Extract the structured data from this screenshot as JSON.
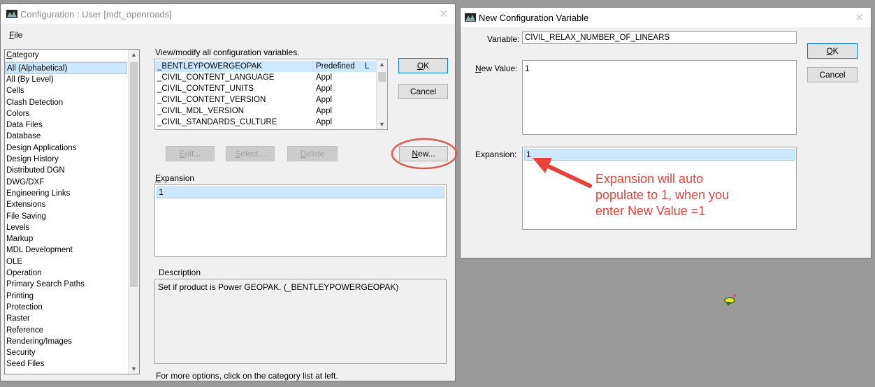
{
  "config_window": {
    "title": "Configuration : User [mdt_openroads]",
    "menu_file": "File",
    "category_header": "Category",
    "categories": [
      "All (Alphabetical)",
      "All (By Level)",
      "Cells",
      "Clash Detection",
      "Colors",
      "Data Files",
      "Database",
      "Design Applications",
      "Design History",
      "Distributed DGN",
      "DWG/DXF",
      "Engineering Links",
      "Extensions",
      "File Saving",
      "Levels",
      "Markup",
      "MDL Development",
      "OLE",
      "Operation",
      "Primary Search Paths",
      "Printing",
      "Protection",
      "Raster",
      "Reference",
      "Rendering/Images",
      "Security",
      "Seed Files"
    ],
    "view_label": "View/modify all configuration variables.",
    "variables": [
      {
        "name": "_BENTLEYPOWERGEOPAK",
        "level": "Predefined",
        "lock": "L"
      },
      {
        "name": "_CIVIL_CONTENT_LANGUAGE",
        "level": "Appl",
        "lock": ""
      },
      {
        "name": "_CIVIL_CONTENT_UNITS",
        "level": "Appl",
        "lock": ""
      },
      {
        "name": "_CIVIL_CONTENT_VERSION",
        "level": "Appl",
        "lock": ""
      },
      {
        "name": "_CIVIL_MDL_VERSION",
        "level": "Appl",
        "lock": ""
      },
      {
        "name": "_CIVIL_STANDARDS_CULTURE",
        "level": "Appl",
        "lock": ""
      }
    ],
    "ok_label": "OK",
    "cancel_label": "Cancel",
    "edit_label": "Edit...",
    "select_label": "Select...",
    "delete_label": "Delete",
    "new_label": "New...",
    "expansion_label": "Expansion",
    "expansion_value": "1",
    "description_label": "Description",
    "description_value": "Set if product is Power GEOPAK. (_BENTLEYPOWERGEOPAK)",
    "footer_hint": "For more options, click on the category list at left."
  },
  "new_var_dialog": {
    "title": "New Configuration Variable",
    "variable_label": "Variable:",
    "variable_value": "CIVIL_RELAX_NUMBER_OF_LINEARS",
    "new_value_label": "New Value:",
    "new_value": "1",
    "expansion_label": "Expansion:",
    "expansion_value": "1",
    "ok_label": "OK",
    "cancel_label": "Cancel"
  },
  "annotation": {
    "line1": "Expansion will auto",
    "line2": "populate to 1, when you",
    "line3": "enter New Value =1",
    "color": "#e8413a"
  },
  "icons": {
    "app": "bentley-app-icon",
    "close": "close-icon",
    "cursor": "ufo-cursor-icon"
  }
}
